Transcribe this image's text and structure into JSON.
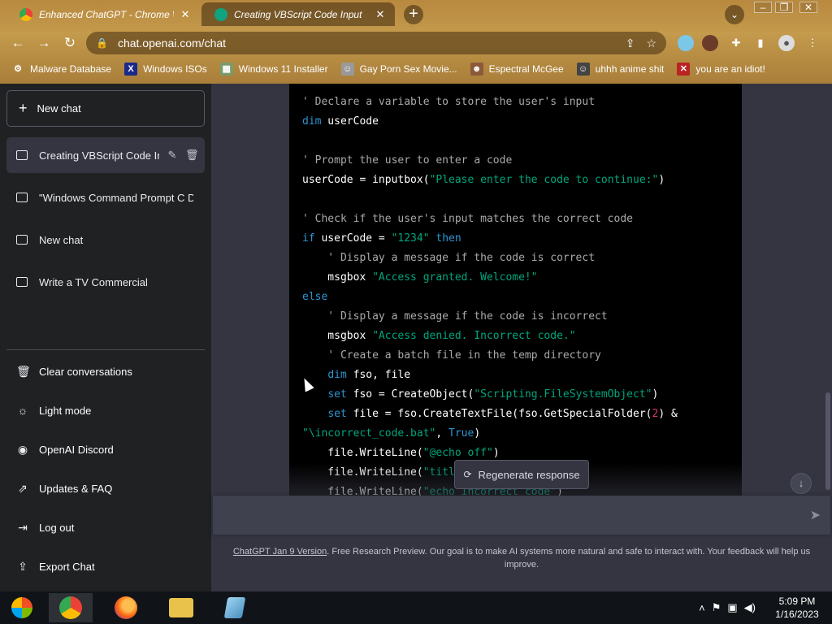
{
  "browser": {
    "tabs": [
      {
        "title": "Enhanced ChatGPT - Chrome Web",
        "active": false
      },
      {
        "title": "Creating VBScript Code Input",
        "active": true
      }
    ],
    "new_tab": "+",
    "tab_search": "⌄",
    "window_buttons": [
      "–",
      "❐",
      "✕"
    ],
    "url": "chat.openai.com/chat",
    "bookmarks": [
      {
        "label": "Malware Database",
        "icon": "gear-icon"
      },
      {
        "label": "Windows ISOs",
        "icon": "x-icon"
      },
      {
        "label": "Windows 11 Installer",
        "icon": "image-icon"
      },
      {
        "label": "Gay Porn Sex Movie...",
        "icon": "face-icon"
      },
      {
        "label": "Espectral McGee",
        "icon": "face-icon"
      },
      {
        "label": "uhhh anime shit",
        "icon": "face-icon"
      },
      {
        "label": "you are an idiot!",
        "icon": "flag-icon"
      }
    ]
  },
  "sidebar": {
    "new_chat": "New chat",
    "conversations": [
      {
        "label": "Creating VBScript Code In",
        "active": true
      },
      {
        "label": "\"Windows Command Prompt C D",
        "active": false
      },
      {
        "label": "New chat",
        "active": false
      },
      {
        "label": "Write a TV Commercial",
        "active": false
      }
    ],
    "menu": [
      {
        "label": "Clear conversations",
        "icon": "trash-icon"
      },
      {
        "label": "Light mode",
        "icon": "sun-icon"
      },
      {
        "label": "OpenAI Discord",
        "icon": "discord-icon"
      },
      {
        "label": "Updates & FAQ",
        "icon": "external-link-icon"
      },
      {
        "label": "Log out",
        "icon": "logout-icon"
      },
      {
        "label": "Export Chat",
        "icon": "export-icon"
      }
    ]
  },
  "code": {
    "lines": [
      [
        {
          "t": "' Declare a variable to store the user's input",
          "c": "c-comment"
        }
      ],
      [
        {
          "t": "dim",
          "c": "c-kw"
        },
        {
          "t": " userCode",
          "c": ""
        }
      ],
      [],
      [
        {
          "t": "' Prompt the user to enter a code",
          "c": "c-comment"
        }
      ],
      [
        {
          "t": "userCode = inputbox(",
          "c": ""
        },
        {
          "t": "\"Please enter the code to continue:\"",
          "c": "c-str"
        },
        {
          "t": ")",
          "c": ""
        }
      ],
      [],
      [
        {
          "t": "' Check if the user's input matches the correct code",
          "c": "c-comment"
        }
      ],
      [
        {
          "t": "if",
          "c": "c-kw"
        },
        {
          "t": " userCode = ",
          "c": ""
        },
        {
          "t": "\"1234\"",
          "c": "c-str"
        },
        {
          "t": " then",
          "c": "c-kw"
        }
      ],
      [
        {
          "t": "    ' Display a message if the code is correct",
          "c": "c-comment"
        }
      ],
      [
        {
          "t": "    msgbox ",
          "c": ""
        },
        {
          "t": "\"Access granted. Welcome!\"",
          "c": "c-str"
        }
      ],
      [
        {
          "t": "else",
          "c": "c-kw"
        }
      ],
      [
        {
          "t": "    ' Display a message if the code is incorrect",
          "c": "c-comment"
        }
      ],
      [
        {
          "t": "    msgbox ",
          "c": ""
        },
        {
          "t": "\"Access denied. Incorrect code.\"",
          "c": "c-str"
        }
      ],
      [
        {
          "t": "    ' Create a batch file in the temp directory",
          "c": "c-comment"
        }
      ],
      [
        {
          "t": "    ",
          "c": ""
        },
        {
          "t": "dim",
          "c": "c-kw"
        },
        {
          "t": " fso, file",
          "c": ""
        }
      ],
      [
        {
          "t": "    ",
          "c": ""
        },
        {
          "t": "set",
          "c": "c-kw"
        },
        {
          "t": " fso = CreateObject(",
          "c": ""
        },
        {
          "t": "\"Scripting.FileSystemObject\"",
          "c": "c-str"
        },
        {
          "t": ")",
          "c": ""
        }
      ],
      [
        {
          "t": "    ",
          "c": ""
        },
        {
          "t": "set",
          "c": "c-kw"
        },
        {
          "t": " file = fso.CreateTextFile(fso.GetSpecialFolder(",
          "c": ""
        },
        {
          "t": "2",
          "c": "c-num"
        },
        {
          "t": ") &",
          "c": ""
        }
      ],
      [
        {
          "t": "\"\\incorrect_code.bat\"",
          "c": "c-str"
        },
        {
          "t": ", ",
          "c": ""
        },
        {
          "t": "True",
          "c": "c-kw"
        },
        {
          "t": ")",
          "c": ""
        }
      ],
      [
        {
          "t": "    file.WriteLine(",
          "c": ""
        },
        {
          "t": "\"@echo off\"",
          "c": "c-str"
        },
        {
          "t": ")",
          "c": ""
        }
      ],
      [
        {
          "t": "    file.WriteLine(",
          "c": ""
        },
        {
          "t": "\"title",
          "c": "c-str"
        }
      ],
      [
        {
          "t": "    file.WriteLine(",
          "c": ""
        },
        {
          "t": "\"echo Incorrect code\"",
          "c": "c-str"
        },
        {
          "t": ")",
          "c": ""
        }
      ]
    ]
  },
  "regenerate_label": "Regenerate response",
  "scroll_down_icon": "↓",
  "send_icon": "➤",
  "footer": {
    "link": "ChatGPT Jan 9 Version",
    "text": ". Free Research Preview. Our goal is to make AI systems more natural and safe to interact with. Your feedback will help us improve."
  },
  "taskbar": {
    "apps": [
      "start-button",
      "chrome",
      "firefox",
      "file-explorer",
      "notepad"
    ],
    "time": "5:09 PM",
    "date": "1/16/2023"
  },
  "colors": {
    "sidebar_bg": "#202123",
    "main_bg": "#343541",
    "code_bg": "#000000",
    "keyword": "#2e95d3",
    "string": "#00a67d"
  }
}
